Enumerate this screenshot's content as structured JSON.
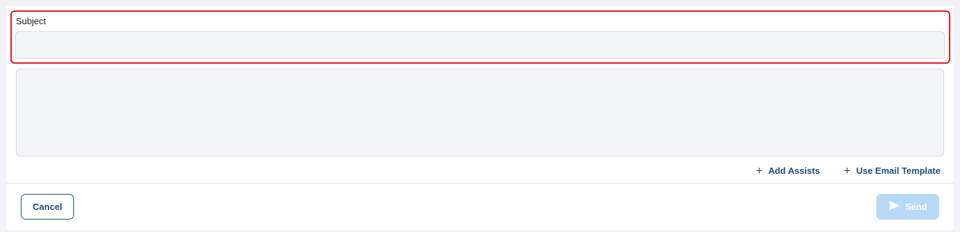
{
  "form": {
    "subject_label": "Subject",
    "subject_value": "",
    "body_value": ""
  },
  "actions": {
    "add_assists": "Add Assists",
    "use_email_template": "Use Email Template"
  },
  "footer": {
    "cancel_label": "Cancel",
    "send_label": "Send",
    "send_disabled": true
  },
  "colors": {
    "highlight_border": "#e01b24",
    "primary": "#1f4e79",
    "send_disabled_bg": "#b7d9f5"
  },
  "icons": {
    "plus": "plus-icon",
    "send": "paper-plane-icon"
  }
}
